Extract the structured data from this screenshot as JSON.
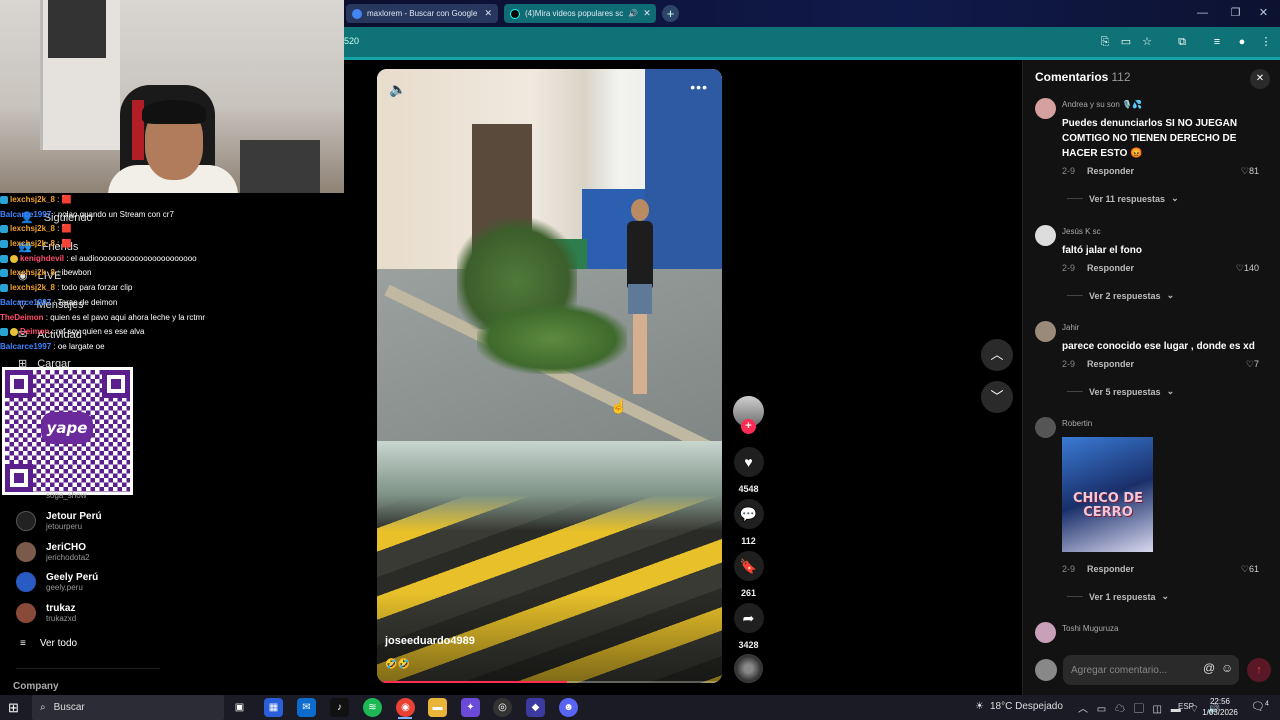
{
  "browser": {
    "tabs": [
      {
        "title": "maxlorem - Buscar con Google",
        "favicon_color": "#4285f4"
      },
      {
        "title": "(4)Mira videos populares sc",
        "favicon_color": "#000000",
        "audio": true
      }
    ],
    "address_fragment": "520",
    "window_controls": [
      "—",
      "❐",
      "✕"
    ],
    "toolbar_icons": [
      "translate-icon",
      "cast-icon",
      "star-icon",
      "extensions-icon",
      "media-icon",
      "profile-icon",
      "menu-icon"
    ]
  },
  "stream_overlay": {
    "chat": [
      {
        "user": "lexchsj2k_8",
        "msg": " : 🟥",
        "color": "#f0a22a"
      },
      {
        "user": "Balcarce1997",
        "msg": " : nolao quando un Stream con cr7",
        "color": "#3d83ff"
      },
      {
        "user": "lexchsj2k_8",
        "msg": " : 🟥",
        "color": "#f0a22a"
      },
      {
        "user": "lexchsj2k_8",
        "msg": " : 🟥",
        "color": "#f0a22a"
      },
      {
        "user": "kenighdevil",
        "msg": " : el audiooooooooooooooooooooooo",
        "color": "#ff4d6a"
      },
      {
        "user": "lexchsj2k_8",
        "msg": " : ibewbon",
        "color": "#f0a22a"
      },
      {
        "user": "lexchsj2k_8",
        "msg": " : todo para forzar clip",
        "color": "#f0a22a"
      },
      {
        "user": "Balcarce1997",
        "msg": " : Tarae de deimon",
        "color": "#3d83ff"
      },
      {
        "user": "TheDeimon",
        "msg": " : quien es el pavo aqui ahora leche y la rctmr",
        "color": "#ff4d6a"
      },
      {
        "user": "Deimon",
        "msg": " : ref soy quien es ese alva",
        "color": "#ff4d6a"
      },
      {
        "user": "Balcarce1997",
        "msg": " : oe largate oe",
        "color": "#3d83ff"
      }
    ],
    "qr_brand": "yape"
  },
  "sidebar": {
    "nav": [
      {
        "label": "Siguiendo",
        "icon": "following-icon"
      },
      {
        "label": "Friends",
        "icon": "friends-icon"
      },
      {
        "label": "LIVE",
        "icon": "live-icon"
      },
      {
        "label": "Mensajes",
        "icon": "messages-icon"
      },
      {
        "label": "Actividad",
        "icon": "activity-icon"
      },
      {
        "label": "Cargar",
        "icon": "upload-icon"
      }
    ],
    "accounts_partial": "soga_show",
    "accounts": [
      {
        "name": "Jetour Perú",
        "handle": "jetourperu",
        "color": "#222222"
      },
      {
        "name": "JeriCHO",
        "handle": "jerichodota2",
        "color": "#7a5a4a"
      },
      {
        "name": "Geely Perú",
        "handle": "geely.peru",
        "color": "#2a5ac4"
      },
      {
        "name": "trukaz",
        "handle": "trukazxd",
        "color": "#8a4a3a"
      }
    ],
    "see_all": "Ver todo",
    "company": "Company"
  },
  "video": {
    "username": "joseeduardo4989",
    "emojis": "🤣🤣",
    "progress": 0.55,
    "likes": "4548",
    "comments": "112",
    "saves": "261",
    "shares": "3428"
  },
  "comments_panel": {
    "title": "Comentarios",
    "count": "112",
    "reply_label": "Responder",
    "items": [
      {
        "user": "Andrea y su son 🎙️💦",
        "text": "Puedes denunciarlos SI NO JUEGAN COMTIGO NO TIENEN DERECHO DE HACER ESTO 😡",
        "date": "2-9",
        "likes": "81",
        "replies": "Ver 11 respuestas",
        "avatar": "#d4a0a0"
      },
      {
        "user": "Jesús K sc",
        "text": "faltó jalar el fono",
        "date": "2-9",
        "likes": "140",
        "replies": "Ver 2 respuestas",
        "avatar": "#dddddd"
      },
      {
        "user": "Jahir",
        "text": "parece conocido ese lugar , donde es xd",
        "date": "2-9",
        "likes": "7",
        "replies": "Ver 5 respuestas",
        "avatar": "#9a8a7a"
      },
      {
        "user": "Robertin",
        "text": "",
        "image_text": "CHICO DE CERRO",
        "date": "2-9",
        "likes": "61",
        "replies": "Ver 1 respuesta",
        "avatar": "#555555"
      },
      {
        "user": "Toshi Muguruza",
        "text": "",
        "avatar": "#c8a0b8"
      }
    ],
    "input_placeholder": "Agregar comentario..."
  },
  "taskbar": {
    "search_placeholder": "Buscar",
    "weather": "18°C  Despejado",
    "lang": "ESP",
    "time": "22:56",
    "date": "1/03/2026",
    "notifications": "4"
  }
}
